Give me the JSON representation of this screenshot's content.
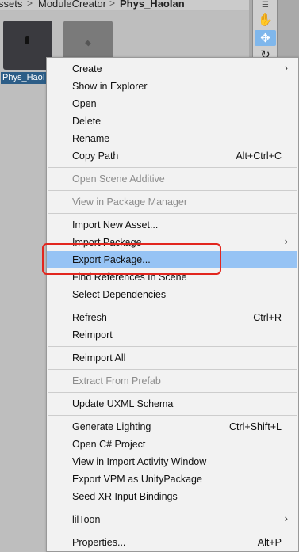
{
  "breadcrumb": {
    "items": [
      "ssets",
      "ModuleCreator",
      "Phys_HaoIan"
    ],
    "separator": ">"
  },
  "assets": {
    "tiles": [
      {
        "label": "Phys_HaoI"
      },
      {
        "label": ""
      }
    ]
  },
  "tools": {
    "grip": "☰",
    "hand": "✋",
    "move": "✥",
    "rotate": "↻"
  },
  "menu": {
    "items": [
      {
        "label": "Create",
        "shortcut": "",
        "submenu": true,
        "disabled": false
      },
      {
        "label": "Show in Explorer",
        "shortcut": "",
        "submenu": false,
        "disabled": false
      },
      {
        "label": "Open",
        "shortcut": "",
        "submenu": false,
        "disabled": false
      },
      {
        "label": "Delete",
        "shortcut": "",
        "submenu": false,
        "disabled": false
      },
      {
        "label": "Rename",
        "shortcut": "",
        "submenu": false,
        "disabled": false
      },
      {
        "label": "Copy Path",
        "shortcut": "Alt+Ctrl+C",
        "submenu": false,
        "disabled": false
      },
      {
        "label": "Open Scene Additive",
        "shortcut": "",
        "submenu": false,
        "disabled": true
      },
      {
        "label": "View in Package Manager",
        "shortcut": "",
        "submenu": false,
        "disabled": true
      },
      {
        "label": "Import New Asset...",
        "shortcut": "",
        "submenu": false,
        "disabled": false
      },
      {
        "label": "Import Package",
        "shortcut": "",
        "submenu": true,
        "disabled": false
      },
      {
        "label": "Export Package...",
        "shortcut": "",
        "submenu": false,
        "disabled": false,
        "highlighted": true
      },
      {
        "label": "Find References In Scene",
        "shortcut": "",
        "submenu": false,
        "disabled": false
      },
      {
        "label": "Select Dependencies",
        "shortcut": "",
        "submenu": false,
        "disabled": false
      },
      {
        "label": "Refresh",
        "shortcut": "Ctrl+R",
        "submenu": false,
        "disabled": false
      },
      {
        "label": "Reimport",
        "shortcut": "",
        "submenu": false,
        "disabled": false
      },
      {
        "label": "Reimport All",
        "shortcut": "",
        "submenu": false,
        "disabled": false
      },
      {
        "label": "Extract From Prefab",
        "shortcut": "",
        "submenu": false,
        "disabled": true
      },
      {
        "label": "Update UXML Schema",
        "shortcut": "",
        "submenu": false,
        "disabled": false
      },
      {
        "label": "Generate Lighting",
        "shortcut": "Ctrl+Shift+L",
        "submenu": false,
        "disabled": false
      },
      {
        "label": "Open C# Project",
        "shortcut": "",
        "submenu": false,
        "disabled": false
      },
      {
        "label": "View in Import Activity Window",
        "shortcut": "",
        "submenu": false,
        "disabled": false
      },
      {
        "label": "Export VPM as UnityPackage",
        "shortcut": "",
        "submenu": false,
        "disabled": false
      },
      {
        "label": "Seed XR Input Bindings",
        "shortcut": "",
        "submenu": false,
        "disabled": false
      },
      {
        "label": "lilToon",
        "shortcut": "",
        "submenu": true,
        "disabled": false
      },
      {
        "label": "Properties...",
        "shortcut": "Alt+P",
        "submenu": false,
        "disabled": false
      }
    ],
    "submenu_arrow": "›"
  },
  "colors": {
    "menu_bg": "#f2f2f2",
    "highlight": "#96c3f4",
    "annotation": "#e2261e",
    "selected_label": "#2c5d87",
    "move_tool": "#7fb7ec"
  }
}
